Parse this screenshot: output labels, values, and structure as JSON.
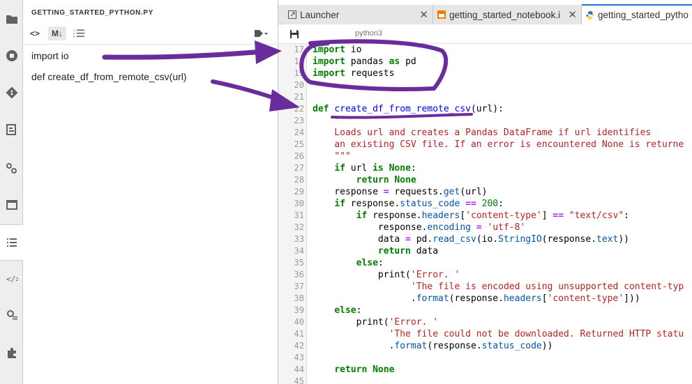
{
  "toc": {
    "title": "GETTING_STARTED_PYTHON.PY",
    "toolbar": {
      "code_toggle": "<>",
      "markdown_toggle": "M↓"
    },
    "items": [
      "import io",
      "def create_df_from_remote_csv(url)"
    ]
  },
  "tabs": [
    {
      "label": "Launcher",
      "icon": "launcher-icon"
    },
    {
      "label": "getting_started_notebook.i",
      "icon": "notebook-icon"
    },
    {
      "label": "getting_started_pytho",
      "icon": "python-icon"
    }
  ],
  "editor": {
    "kernel": "python3",
    "lines": [
      {
        "n": "17",
        "text": "import io"
      },
      {
        "n": "18",
        "text": "import pandas as pd"
      },
      {
        "n": "19",
        "text": "import requests"
      },
      {
        "n": "20",
        "text": ""
      },
      {
        "n": "21",
        "text": ""
      },
      {
        "n": "22",
        "text": "def create_df_from_remote_csv(url):"
      },
      {
        "n": "23",
        "text": "    \"\"\""
      },
      {
        "n": "24",
        "text": "    Loads url and creates a Pandas DataFrame if url identifies"
      },
      {
        "n": "25",
        "text": "    an existing CSV file. If an error is encountered None is returne"
      },
      {
        "n": "26",
        "text": "    \"\"\""
      },
      {
        "n": "27",
        "text": "    if url is None:"
      },
      {
        "n": "28",
        "text": "        return None"
      },
      {
        "n": "29",
        "text": "    response = requests.get(url)"
      },
      {
        "n": "30",
        "text": "    if response.status_code == 200:"
      },
      {
        "n": "31",
        "text": "        if response.headers['content-type'] == \"text/csv\":"
      },
      {
        "n": "32",
        "text": "            response.encoding = 'utf-8'"
      },
      {
        "n": "33",
        "text": "            data = pd.read_csv(io.StringIO(response.text))"
      },
      {
        "n": "34",
        "text": "            return data"
      },
      {
        "n": "35",
        "text": "        else:"
      },
      {
        "n": "36",
        "text": "            print('Error. '"
      },
      {
        "n": "37",
        "text": "                  'The file is encoded using unsupported content-typ"
      },
      {
        "n": "38",
        "text": "                  .format(response.headers['content-type']))"
      },
      {
        "n": "39",
        "text": "    else:"
      },
      {
        "n": "40",
        "text": "        print('Error. '"
      },
      {
        "n": "41",
        "text": "              'The file could not be downloaded. Returned HTTP statu"
      },
      {
        "n": "42",
        "text": "              .format(response.status_code))"
      },
      {
        "n": "43",
        "text": ""
      },
      {
        "n": "44",
        "text": "    return None"
      },
      {
        "n": "45",
        "text": ""
      }
    ]
  },
  "colors": {
    "accent": "#1976d2",
    "annotation": "#6a2c9a",
    "keyword": "#008000",
    "string": "#ba2121"
  }
}
